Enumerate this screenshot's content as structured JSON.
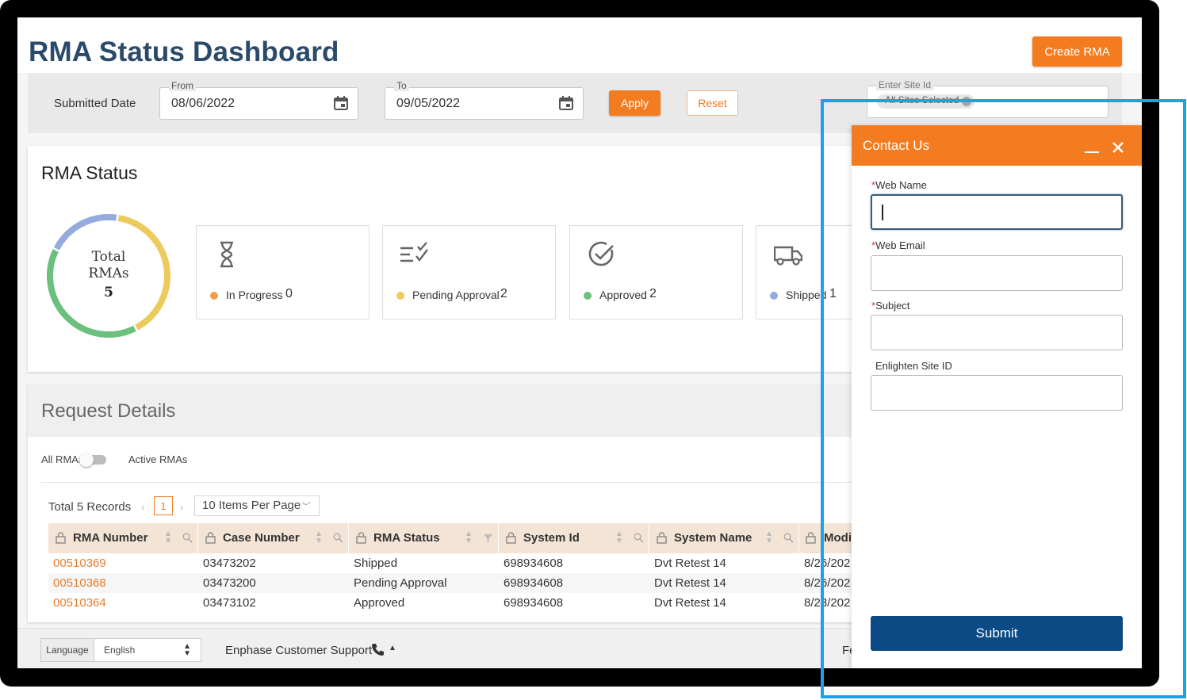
{
  "header": {
    "title": "RMA Status Dashboard",
    "create_button": "Create RMA"
  },
  "filters": {
    "submitted_label": "Submitted Date",
    "from_label": "From",
    "from_value": "08/06/2022",
    "to_label": "To",
    "to_value": "09/05/2022",
    "apply_label": "Apply",
    "reset_label": "Reset",
    "site_label": "Enter Site Id",
    "site_chip": "All Sites Selected"
  },
  "status": {
    "title": "RMA Status",
    "donut_label_1": "Total",
    "donut_label_2": "RMAs",
    "total": "5",
    "donut_segments": [
      {
        "label": "In Progress",
        "value": 0,
        "color": "#f0a045"
      },
      {
        "label": "Pending Approval",
        "value": 2,
        "color": "#ecca5c"
      },
      {
        "label": "Approved",
        "value": 2,
        "color": "#6cc07d"
      },
      {
        "label": "Shipped",
        "value": 1,
        "color": "#94acdd"
      }
    ],
    "cards": [
      {
        "label": "In Progress",
        "count": "0",
        "dot": "#f0a045"
      },
      {
        "label": "Pending Approval",
        "count": "2",
        "dot": "#ecca5c"
      },
      {
        "label": "Approved",
        "count": "2",
        "dot": "#6cc07d"
      },
      {
        "label": "Shipped",
        "count": "1",
        "dot": "#94acdd"
      }
    ]
  },
  "requests": {
    "title": "Request Details",
    "toggle_left": "All RMAs",
    "toggle_right": "Active RMAs",
    "total_records": "Total 5 Records",
    "page": "1",
    "per_page": "10 Items Per Page",
    "columns": [
      "RMA Number",
      "Case Number",
      "RMA Status",
      "System Id",
      "System Name",
      "Modi"
    ],
    "rows": [
      [
        "00510369",
        "03473202",
        "Shipped",
        "698934608",
        "Dvt Retest 14",
        "8/26/202"
      ],
      [
        "00510368",
        "03473200",
        "Pending Approval",
        "698934608",
        "Dvt Retest 14",
        "8/26/202"
      ],
      [
        "00510364",
        "03473102",
        "Approved",
        "698934608",
        "Dvt Retest 14",
        "8/23/202"
      ]
    ]
  },
  "footer": {
    "language_label": "Language",
    "language_value": "English",
    "support": "Enphase Customer Support",
    "fe": "Fe"
  },
  "contact": {
    "title": "Contact Us",
    "web_name": "Web Name",
    "web_email": "Web Email",
    "subject": "Subject",
    "site_id": "Enlighten Site ID",
    "required_mark": "*",
    "submit": "Submit"
  },
  "colors": {
    "accent": "#f47c20",
    "title": "#2a4a6b",
    "submit": "#0b4a85",
    "highlight": "#1aa3e8"
  }
}
